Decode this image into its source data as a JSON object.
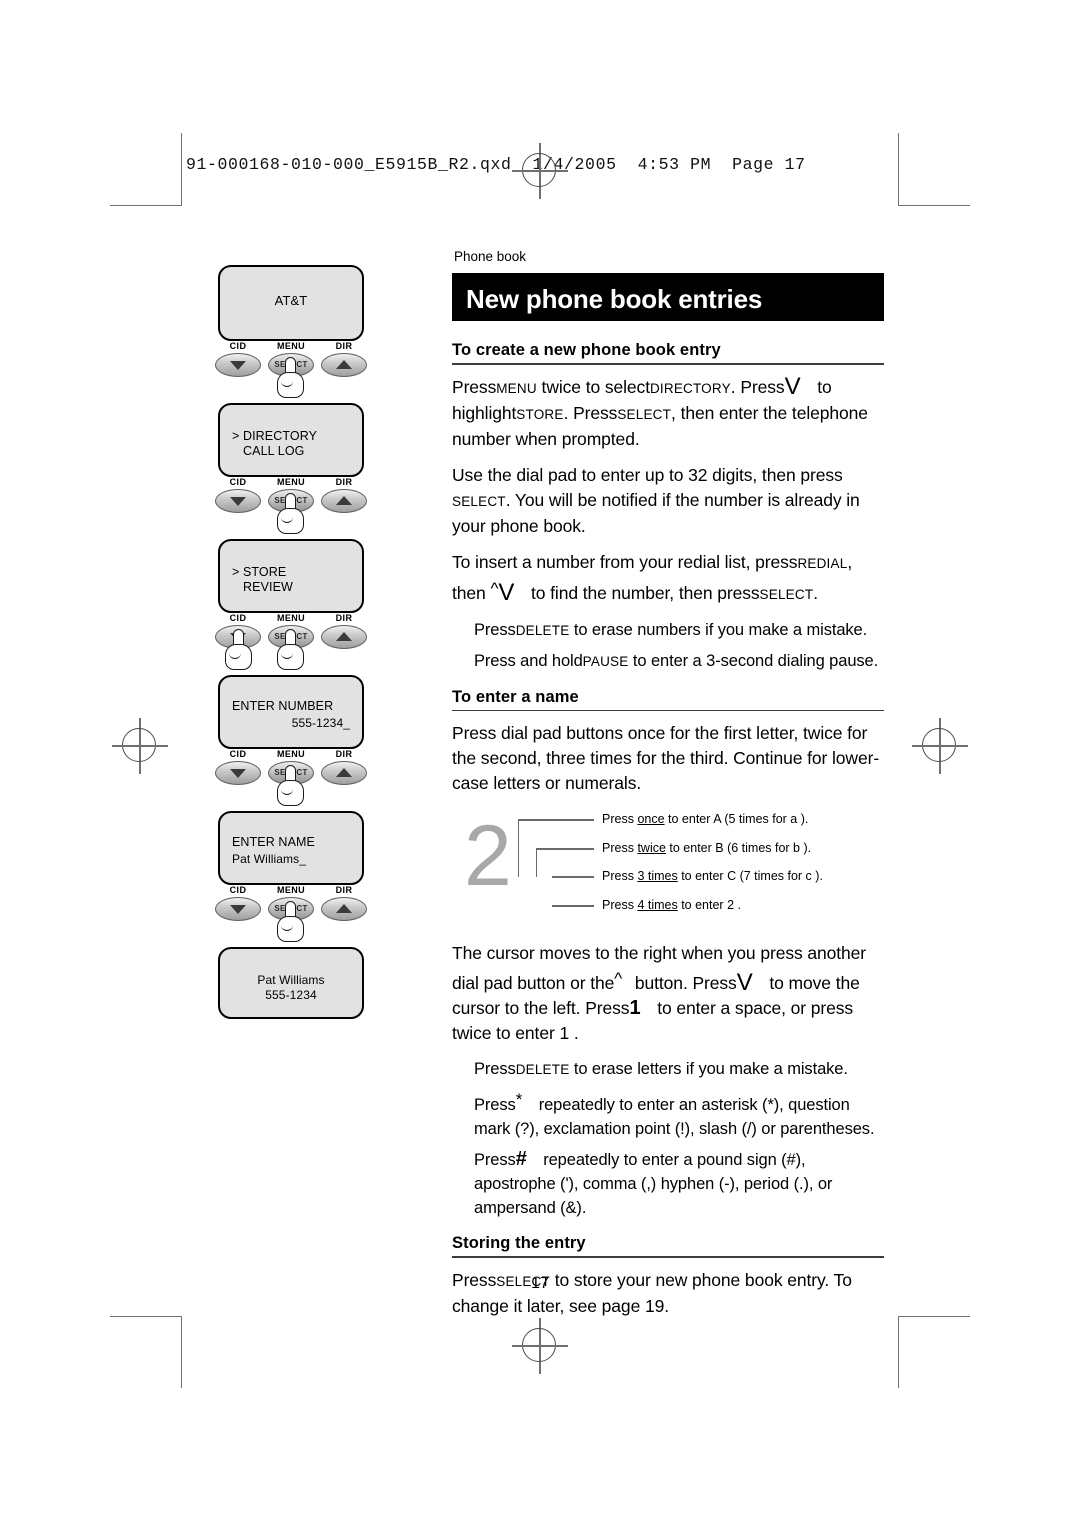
{
  "print_header": "91-000168-010-000_E5915B_R2.qxd  1/4/2005  4:53 PM  Page 17",
  "page_number": "17",
  "kicker": "Phone book",
  "banner_title": "New phone book entries",
  "sections": {
    "create": {
      "heading": "To create a new phone book entry",
      "p1": {
        "a": "Press",
        "k1": "MENU",
        "b": " twice to select",
        "k2": "DIRECTORY",
        "c": ". Press",
        "k3": "V",
        "d": " to highlight",
        "k4": "STORE",
        "e": ". Press",
        "k5": "SELECT",
        "f": ", then enter the telephone number when prompted."
      },
      "p2": {
        "a": "Use the dial pad to enter up to 32 digits, then press ",
        "k1": "SELECT",
        "b": ". You will be notified if the number is already in your phone book."
      },
      "p3": {
        "a": "To insert a number from your redial list, press",
        "k1": "REDIAL",
        "b": ", then ",
        "k2": "^",
        "k3": "V",
        "c": " to find the number, then press",
        "k4": "SELECT",
        "d": "."
      },
      "p4": {
        "a": "Press",
        "k1": "DELETE",
        "b": " to erase numbers if you make a mistake."
      },
      "p5": {
        "a": "Press and hold",
        "k1": "PAUSE",
        "b": " to enter a 3-second dialing pause."
      }
    },
    "name": {
      "heading": "To enter a name",
      "p1": "Press dial pad buttons once for the first letter, twice for the second, three times for the third. Continue for lower-case letters or numerals.",
      "p2": {
        "a": "The cursor moves to the right when you press another dial pad button or the",
        "k1": "^",
        "b": " button. Press",
        "k2": "V",
        "c": " to move the cursor to the left. Press",
        "k3": "1",
        "d": " to enter a space, or press twice to enter  1 ."
      },
      "p3": {
        "a": "Press",
        "k1": "DELETE",
        "b": " to erase letters if you make a mistake."
      },
      "p4": {
        "a": "Press",
        "k1": "*",
        "b": " repeatedly to enter an asterisk (*), question mark (?), exclamation point (!), slash (/) or parentheses."
      },
      "p5": {
        "a": "Press",
        "k1": "#",
        "b": " repeatedly to enter a pound sign (#), apostrophe ('), comma (,) hyphen (-), period (.), or ampersand (&)."
      }
    },
    "storing": {
      "heading": "Storing the entry",
      "p1": {
        "a": "Press",
        "k1": "SELECT",
        "b": " to store your new phone book entry. To change it later, see page 19."
      }
    }
  },
  "dialpad_diagram": {
    "key_digit": "2",
    "callouts": [
      {
        "pre": "Press ",
        "emph": "once",
        "post": " to enter  A  (5 times for  a )."
      },
      {
        "pre": "Press ",
        "emph": "twice",
        "post": " to enter  B  (6 times for  b )."
      },
      {
        "pre": "Press ",
        "emph": "3 times",
        "post": " to enter  C  (7 times for  c )."
      },
      {
        "pre": "Press ",
        "emph": "4 times",
        "post": " to enter  2 ."
      }
    ]
  },
  "illustration": {
    "button_labels": {
      "left": "CID",
      "middle": "MENU",
      "right": "DIR",
      "select": "SELECT"
    },
    "panels": [
      {
        "id": "panel-att",
        "display": "AT&T"
      },
      {
        "id": "panel-directory",
        "line1": "> DIRECTORY",
        "line2": "CALL LOG"
      },
      {
        "id": "panel-store",
        "line1": "> STORE",
        "line2": "REVIEW"
      },
      {
        "id": "panel-enter-number",
        "line1": "ENTER NUMBER",
        "line2": "555-1234_"
      },
      {
        "id": "panel-enter-name",
        "line1": "ENTER NAME",
        "line2": "Pat Williams_"
      },
      {
        "id": "panel-saved",
        "line1": "Pat Williams",
        "line2": "555-1234"
      }
    ]
  }
}
